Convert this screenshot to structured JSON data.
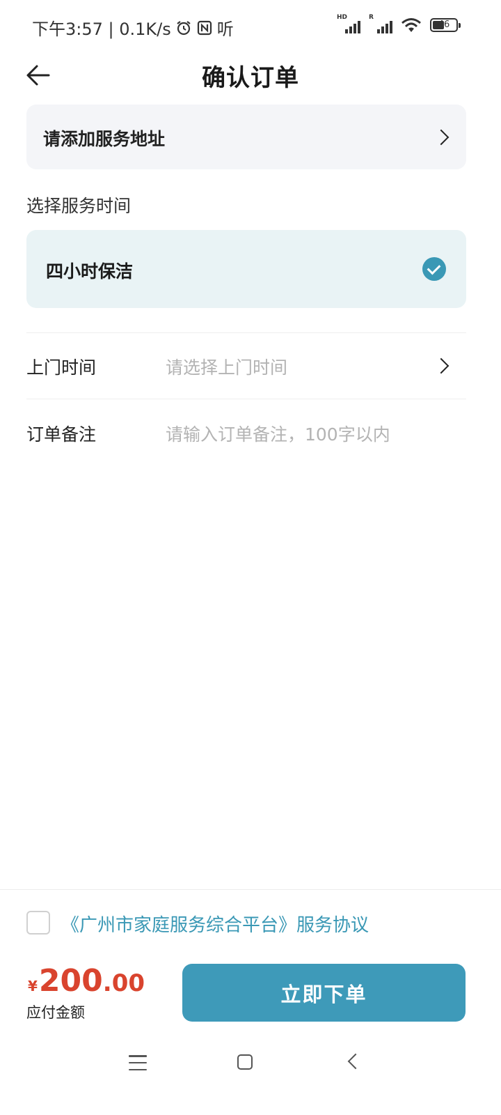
{
  "status_bar": {
    "time_and_speed": "下午3:57 | 0.1K/s",
    "extra_label": "听",
    "net1_label": "HD",
    "net2_label": "R",
    "battery": "46"
  },
  "header": {
    "title": "确认订单"
  },
  "address": {
    "label": "请添加服务地址"
  },
  "service_time": {
    "section_label": "选择服务时间",
    "selected_option": "四小时保洁"
  },
  "visit_time": {
    "label": "上门时间",
    "placeholder": "请选择上门时间"
  },
  "order_note": {
    "label": "订单备注",
    "placeholder": "请输入订单备注，100字以内"
  },
  "agreement": {
    "text": "《广州市家庭服务综合平台》服务协议",
    "checked": false
  },
  "payment": {
    "currency": "¥",
    "amount_int": "200",
    "amount_dec": ".00",
    "label": "应付金额",
    "submit_label": "立即下单"
  },
  "colors": {
    "accent": "#3e9ab9",
    "price": "#d9442e"
  }
}
